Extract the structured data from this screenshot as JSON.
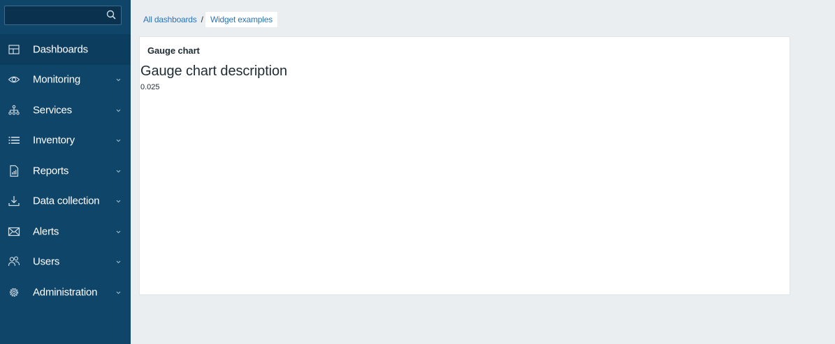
{
  "sidebar": {
    "search": {
      "value": "",
      "placeholder": ""
    },
    "items": [
      {
        "label": "Dashboards",
        "icon": "dashboards-icon",
        "active": true,
        "expandable": false
      },
      {
        "label": "Monitoring",
        "icon": "eye-icon",
        "active": false,
        "expandable": true
      },
      {
        "label": "Services",
        "icon": "hierarchy-icon",
        "active": false,
        "expandable": true
      },
      {
        "label": "Inventory",
        "icon": "list-icon",
        "active": false,
        "expandable": true
      },
      {
        "label": "Reports",
        "icon": "report-icon",
        "active": false,
        "expandable": true
      },
      {
        "label": "Data collection",
        "icon": "download-icon",
        "active": false,
        "expandable": true
      },
      {
        "label": "Alerts",
        "icon": "envelope-icon",
        "active": false,
        "expandable": true
      },
      {
        "label": "Users",
        "icon": "users-icon",
        "active": false,
        "expandable": true
      },
      {
        "label": "Administration",
        "icon": "gear-icon",
        "active": false,
        "expandable": true
      }
    ]
  },
  "breadcrumb": {
    "parent": "All dashboards",
    "separator": "/",
    "current": "Widget examples"
  },
  "widget": {
    "header": "Gauge chart",
    "description": "Gauge chart description",
    "value": "0.025"
  },
  "colors": {
    "sidebar_bg": "#0f4569",
    "page_bg": "#ebeef0",
    "link": "#2a74b8",
    "text": "#1f2c33"
  }
}
